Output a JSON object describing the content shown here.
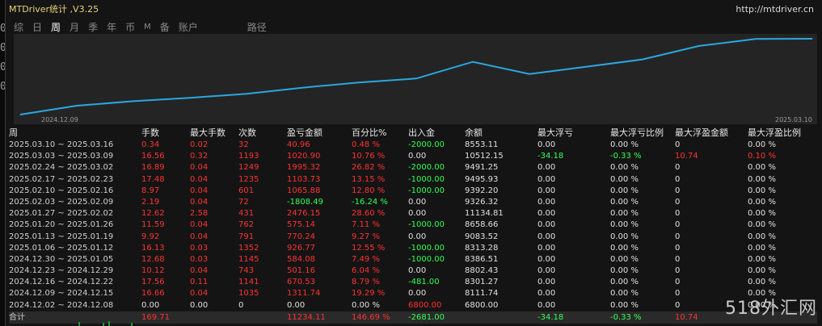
{
  "window": {
    "title": "MTDriver统计 ,V3.25",
    "url": "http://mtdriver.cn"
  },
  "leftstrip": [
    "0",
    "0",
    "0",
    "0"
  ],
  "tabs": [
    {
      "label": "综",
      "active": false
    },
    {
      "label": "日",
      "active": false
    },
    {
      "label": "周",
      "active": true
    },
    {
      "label": "月",
      "active": false
    },
    {
      "label": "季",
      "active": false
    },
    {
      "label": "年",
      "active": false
    },
    {
      "label": "币",
      "active": false
    },
    {
      "label": "M",
      "active": false
    },
    {
      "label": "备",
      "active": false
    },
    {
      "label": "账户",
      "active": false
    },
    {
      "label": "路径",
      "active": false
    }
  ],
  "chart_data": {
    "type": "line",
    "x_start_label": "2024.12.09",
    "x_end_label": "2025.03.10",
    "color": "#2aa7e0",
    "x": [
      "2024.12.02",
      "2024.12.09",
      "2024.12.16",
      "2024.12.23",
      "2024.12.30",
      "2025.01.06",
      "2025.01.13",
      "2025.01.20",
      "2025.01.27",
      "2025.02.03",
      "2025.02.10",
      "2025.02.17",
      "2025.02.24",
      "2025.03.03",
      "2025.03.10"
    ],
    "series": [
      {
        "values": [
          6800.0,
          8111.74,
          8301.27,
          8802.43,
          8386.51,
          8313.28,
          9083.52,
          8658.66,
          11134.81,
          9326.32,
          9392.2,
          9495.93,
          9491.25,
          10512.15,
          8553.11
        ]
      }
    ]
  },
  "table": {
    "headers": [
      "周",
      "手数",
      "最大手数",
      "次数",
      "盈亏金额",
      "百分比%",
      "出入金",
      "余额",
      "最大浮亏",
      "最大浮亏比例",
      "最大浮盈金额",
      "最大浮盈比例"
    ],
    "rows": [
      [
        "2025.03.10 ~ 2025.03.16",
        "0.34",
        "0.02",
        "32",
        "40.96",
        "0.48 %",
        "-2000.00",
        "8553.11",
        "0.00",
        "0.00 %",
        "0",
        "0.00 %"
      ],
      [
        "2025.03.03 ~ 2025.03.09",
        "16.56",
        "0.32",
        "1193",
        "1020.90",
        "10.76 %",
        "0.00",
        "10512.15",
        "-34.18",
        "-0.33 %",
        "10.74",
        "0.10 %"
      ],
      [
        "2025.02.24 ~ 2025.03.02",
        "16.89",
        "0.04",
        "1249",
        "1995.32",
        "26.82 %",
        "-2000.00",
        "9491.25",
        "0.00",
        "0.00 %",
        "0",
        "0.00 %"
      ],
      [
        "2025.02.17 ~ 2025.02.23",
        "17.48",
        "0.04",
        "1235",
        "1103.73",
        "13.15 %",
        "-1000.00",
        "9495.93",
        "0.00",
        "0.00 %",
        "0",
        "0.00 %"
      ],
      [
        "2025.02.10 ~ 2025.02.16",
        "8.97",
        "0.04",
        "601",
        "1065.88",
        "12.80 %",
        "-1000.00",
        "9392.20",
        "0.00",
        "0.00 %",
        "0",
        "0.00 %"
      ],
      [
        "2025.02.03 ~ 2025.02.09",
        "2.19",
        "0.04",
        "72",
        "-1808.49",
        "-16.24 %",
        "0.00",
        "9326.32",
        "0.00",
        "0.00 %",
        "0",
        "0.00 %"
      ],
      [
        "2025.01.27 ~ 2025.02.02",
        "12.62",
        "2.58",
        "431",
        "2476.15",
        "28.60 %",
        "0.00",
        "11134.81",
        "0.00",
        "0.00 %",
        "0",
        "0.00 %"
      ],
      [
        "2025.01.20 ~ 2025.01.26",
        "11.59",
        "0.04",
        "762",
        "575.14",
        "7.11 %",
        "-1000.00",
        "8658.66",
        "0.00",
        "0.00 %",
        "0",
        "0.00 %"
      ],
      [
        "2025.01.13 ~ 2025.01.19",
        "9.92",
        "0.04",
        "791",
        "770.24",
        "9.27 %",
        "0.00",
        "9083.52",
        "0.00",
        "0.00 %",
        "0",
        "0.00 %"
      ],
      [
        "2025.01.06 ~ 2025.01.12",
        "16.13",
        "0.03",
        "1352",
        "926.77",
        "12.55 %",
        "-1000.00",
        "8313.28",
        "0.00",
        "0.00 %",
        "0",
        "0.00 %"
      ],
      [
        "2024.12.30 ~ 2025.01.05",
        "12.68",
        "0.03",
        "1145",
        "584.08",
        "7.49 %",
        "-1000.00",
        "8386.51",
        "0.00",
        "0.00 %",
        "0",
        "0.00 %"
      ],
      [
        "2024.12.23 ~ 2024.12.29",
        "10.12",
        "0.04",
        "743",
        "501.16",
        "6.04 %",
        "0.00",
        "8802.43",
        "0.00",
        "0.00 %",
        "0",
        "0.00 %"
      ],
      [
        "2024.12.16 ~ 2024.12.22",
        "17.56",
        "0.11",
        "1141",
        "670.53",
        "8.79 %",
        "-481.00",
        "8301.27",
        "0.00",
        "0.00 %",
        "0",
        "0.00 %"
      ],
      [
        "2024.12.09 ~ 2024.12.15",
        "16.66",
        "0.04",
        "1035",
        "1311.74",
        "19.29 %",
        "0.00",
        "8111.74",
        "0.00",
        "0.00 %",
        "0",
        "0.00 %"
      ],
      [
        "2024.12.02 ~ 2024.12.08",
        "0.00",
        "0.00",
        "0",
        "0.00",
        "0.00 %",
        "6800.00",
        "6800.00",
        "0.00",
        "0.00 %",
        "0",
        "0.00 %"
      ]
    ],
    "total": [
      "合计",
      "169.71",
      "",
      "",
      "11234.11",
      "146.69 %",
      "-2681.00",
      "",
      "-34.18",
      "-0.33 %",
      "10.74",
      ""
    ]
  },
  "watermark": "518外汇网",
  "colors": {
    "positive": "#ff3333",
    "negative": "#33ff55",
    "line": "#2aa7e0"
  }
}
